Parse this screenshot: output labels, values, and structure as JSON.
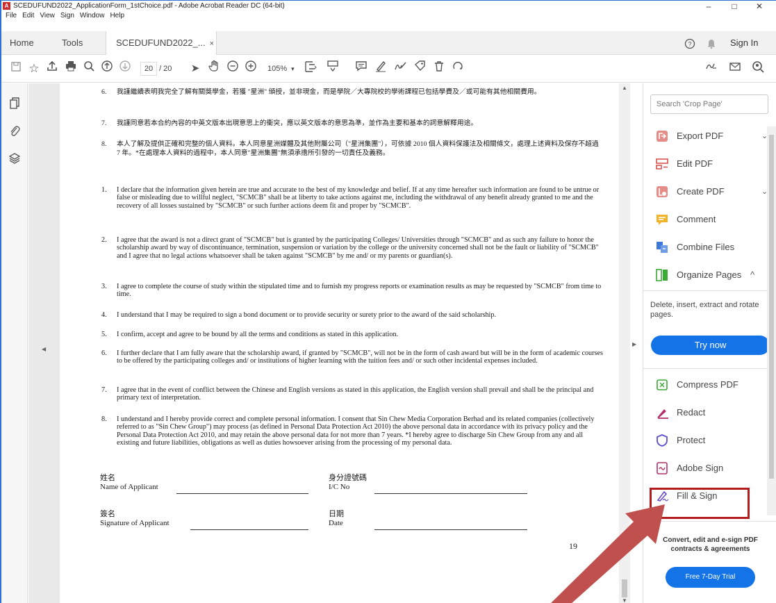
{
  "window": {
    "title": "SCEDUFUND2022_ApplicationForm_1stChoice.pdf - Adobe Acrobat Reader DC (64-bit)",
    "app_icon_letter": "A",
    "minimize": "–",
    "maximize": "□",
    "close": "✕"
  },
  "menu": [
    "File",
    "Edit",
    "View",
    "Sign",
    "Window",
    "Help"
  ],
  "tabs": {
    "home": "Home",
    "tools": "Tools",
    "doc": "SCEDUFUND2022_...",
    "doc_close": "×",
    "sign_in": "Sign In"
  },
  "toolbar": {
    "current_page": "20",
    "page_sep": "/ 20",
    "zoom": "105%"
  },
  "document": {
    "zh_clauses": [
      {
        "num": "6.",
        "text": "我謹繼續表明我完全了解有關獎學金，若獲 \"星洲\" 頒授，並非現金，而是學院／大專院校的學術課程已包括學費及／或可能有其他相關費用。"
      },
      {
        "num": "7.",
        "text": "我謹同意若本合約內容的中英文版本出現意思上的衝突，應以英文版本的意思為準，並作為主要和基本的詞意解釋用途。"
      },
      {
        "num": "8.",
        "text": "本人了解及提供正確和完整的個人資料。本人同意星洲媒體及其他附屬公司（\"星洲集團\"），可依據 2010 個人資料保護法及相關條文，處理上述資料及保存不超過 7 年。*在處理本人資料的過程中，本人同意\"星洲集團\"無須承擔所引發的一切責任及義務。"
      }
    ],
    "en_clauses": [
      {
        "num": "1.",
        "text": "I declare that the information given herein are true and accurate to the best of my knowledge and belief. If at any time hereafter such information are found to be untrue or false or misleading due to willful neglect, \"SCMCB\" shall be at liberty to take actions against me, including the withdrawal of any benefit already granted to me and the recovery of all losses sustained by \"SCMCB\" or such further actions deem fit and proper by \"SCMCB\"."
      },
      {
        "num": "2.",
        "text": "I agree that the award is not a direct grant of \"SCMCB\" but is granted by the participating Colleges/ Universities through \"SCMCB\" and as such any failure to honor the scholarship award by way of discontinuance, termination, suspension or variation by the college or the university concerned shall not be the fault or liability of \"SCMCB\" and I agree that no legal actions whatsoever shall be taken against \"SCMCB\" by me and/ or my parents or guardian(s)."
      },
      {
        "num": "3.",
        "text": "I agree to complete the course of study within the stipulated time and to furnish my progress reports or examination results as may be requested by \"SCMCB\" from time to time."
      },
      {
        "num": "4.",
        "text": "I understand that I may be required to sign a bond document or to provide security or surety prior to the award of the said scholarship."
      },
      {
        "num": "5.",
        "text": "I confirm, accept and agree to be bound by all the terms and conditions as stated in this application."
      },
      {
        "num": "6.",
        "text": "I further declare that I am fully aware that the scholarship award, if granted by \"SCMCB\", will not be in the form of cash award but will be in the form of academic courses to be offered by the participating colleges and/ or institutions of higher learning with the tuition fees and/ or such other incidental expenses included."
      },
      {
        "num": "7.",
        "text": "I agree that in the event of conflict between the Chinese and English versions as stated in this application, the English version shall prevail and shall be the principal and primary text of interpretation."
      },
      {
        "num": "8.",
        "text": "I understand and I hereby provide correct and complete personal information. I consent that Sin Chew Media Corporation Berhad and its related companies (collectively referred to as \"Sin Chew Group\") may process (as defined in Personal Data Protection Act 2010) the above personal data in accordance with its privacy policy and the Personal Data Protection Act 2010, and may retain the above personal data for not more than 7 years. *I hereby agree to discharge Sin Chew Group from any and all existing and future liabilities, obligations as well as duties howsoever arising from the processing of my personal data."
      }
    ],
    "signature": {
      "name_zh": "姓名",
      "name_en": "Name of Applicant",
      "ic_zh": "身分證號碼",
      "ic_en": "I/C No",
      "sign_zh": "簽名",
      "sign_en": "Signature of Applicant",
      "date_zh": "日期",
      "date_en": "Date"
    },
    "page_number": "19"
  },
  "right_panel": {
    "search_placeholder": "Search 'Crop Page'",
    "tools": [
      {
        "label": "Export PDF",
        "icon": "export-pdf-icon",
        "color": "#d9534f",
        "chevron": "⌄"
      },
      {
        "label": "Edit PDF",
        "icon": "edit-pdf-icon",
        "color": "#d9534f",
        "chevron": ""
      },
      {
        "label": "Create PDF",
        "icon": "create-pdf-icon",
        "color": "#d9534f",
        "chevron": "⌄"
      },
      {
        "label": "Comment",
        "icon": "comment-icon",
        "color": "#f0b429",
        "chevron": ""
      },
      {
        "label": "Combine Files",
        "icon": "combine-files-icon",
        "color": "#3d79d8",
        "chevron": ""
      },
      {
        "label": "Organize Pages",
        "icon": "organize-pages-icon",
        "color": "#3aaa35",
        "chevron": "^"
      }
    ],
    "organize_desc": "Delete, insert, extract and rotate pages.",
    "try_now": "Try now",
    "more_tools": [
      {
        "label": "Compress PDF",
        "icon": "compress-pdf-icon",
        "color": "#3aaa35"
      },
      {
        "label": "Redact",
        "icon": "redact-icon",
        "color": "#b3306b"
      },
      {
        "label": "Protect",
        "icon": "protect-icon",
        "color": "#5a4fcf"
      },
      {
        "label": "Adobe Sign",
        "icon": "adobe-sign-icon",
        "color": "#b3306b"
      },
      {
        "label": "Fill & Sign",
        "icon": "fill-sign-icon",
        "color": "#6a4fc9"
      }
    ],
    "promo_text": "Convert, edit and e-sign PDF contracts & agreements",
    "trial_button": "Free 7-Day Trial"
  },
  "colors": {
    "accent": "#1473e6",
    "highlight": "#b11d1d",
    "arrow": "#c0504d"
  }
}
